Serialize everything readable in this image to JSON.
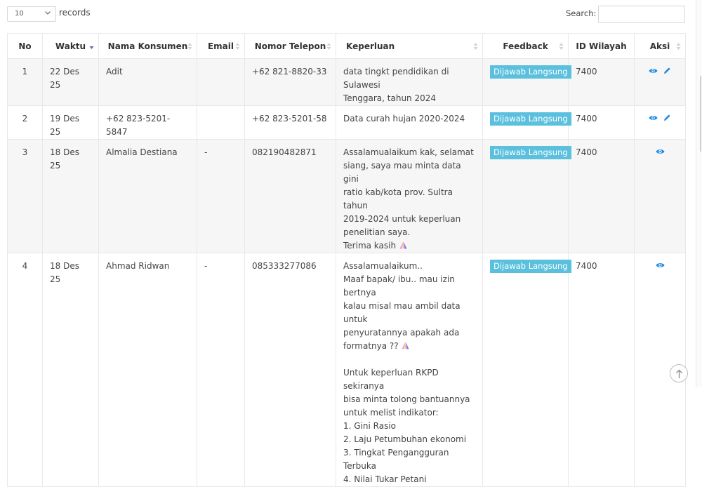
{
  "controls": {
    "length_value": "10",
    "records_label": "records",
    "search_label": "Search:",
    "search_value": ""
  },
  "columns": [
    {
      "key": "no",
      "label": "No"
    },
    {
      "key": "waktu",
      "label": "Waktu"
    },
    {
      "key": "nama",
      "label": "Nama Konsumen"
    },
    {
      "key": "email",
      "label": "Email"
    },
    {
      "key": "telepon",
      "label": "Nomor Telepon"
    },
    {
      "key": "keperluan",
      "label": "Keperluan"
    },
    {
      "key": "feedback",
      "label": "Feedback"
    },
    {
      "key": "wilayah",
      "label": "ID Wilayah"
    },
    {
      "key": "aksi",
      "label": "Aksi"
    }
  ],
  "rows": [
    {
      "no": "1",
      "waktu": "22 Des 25",
      "nama": "Adit",
      "email": "",
      "telepon": "+62 821-8820-33",
      "keperluan": [
        "data tingkt pendidikan di Sulawesi",
        "Tenggara, tahun 2024"
      ],
      "feedback": "Dijawab Langsung",
      "wilayah": "7400",
      "actions": [
        "view-icon",
        "edit-icon"
      ]
    },
    {
      "no": "2",
      "waktu": "19 Des 25",
      "nama": "+62 823-5201-5847",
      "email": "",
      "telepon": "+62 823-5201-58",
      "keperluan": [
        "Data curah hujan 2020-2024"
      ],
      "feedback": "Dijawab Langsung",
      "wilayah": "7400",
      "actions": [
        "view-icon",
        "edit-icon"
      ]
    },
    {
      "no": "3",
      "waktu": "18 Des 25",
      "nama": "Almalia Destiana",
      "email": "-",
      "telepon": "082190482871",
      "keperluan": [
        "Assalamualaikum kak, selamat",
        "siang, saya mau minta data gini",
        "ratio kab/kota prov. Sultra tahun",
        "2019-2024 untuk keperluan",
        "penelitian saya.",
        "Terima kasih"
      ],
      "feedback": "Dijawab Langsung",
      "wilayah": "7400",
      "actions": [
        "view-icon"
      ]
    },
    {
      "no": "4",
      "waktu": "18 Des 25",
      "nama": "Ahmad Ridwan",
      "email": "-",
      "telepon": "085333277086",
      "keperluan": [
        "Assalamualaikum..",
        "Maaf bapak/ ibu.. mau izin bertnya",
        "kalau misal mau ambil data untuk",
        "penyuratannya apakah ada",
        "formatnya ??",
        "",
        "Untuk keperluan RKPD sekiranya",
        "bisa minta tolong bantuannya",
        "untuk melist indikator:",
        "1. Gini Rasio",
        "2. Laju Petumbuhan ekonomi",
        "3. Tingkat Pengangguran Terbuka",
        "4. Nilai Tukar Petani"
      ],
      "feedback": "Dijawab Langsung",
      "wilayah": "7400",
      "actions": [
        "view-icon"
      ]
    }
  ],
  "colors": {
    "badge": "#5bc0de",
    "icon": "#1e88e5",
    "sort_active": "#5c6bc0"
  }
}
